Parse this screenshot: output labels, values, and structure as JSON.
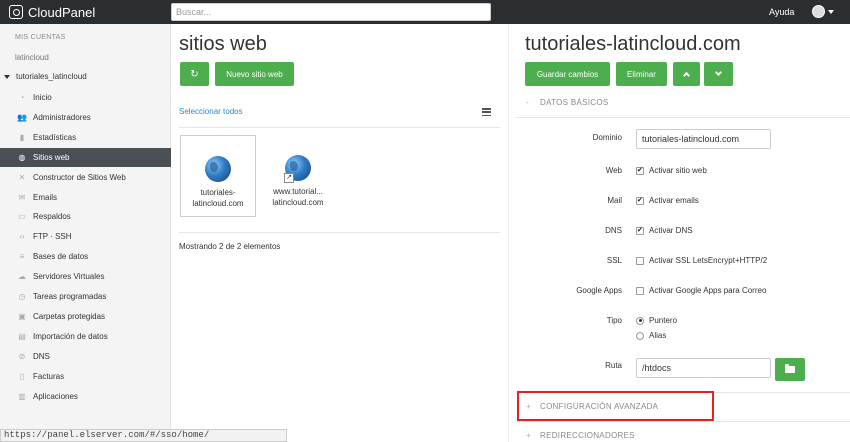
{
  "topbar": {
    "brand": "CloudPanel",
    "search_placeholder": "Buscar...",
    "help_label": "Ayuda"
  },
  "sidebar": {
    "section_heading": "MIS CUENTAS",
    "account": "latincloud",
    "subaccount": "tutoriales_latincloud",
    "items": [
      {
        "label": "Inicio",
        "icon": "dashboard-icon"
      },
      {
        "label": "Administradores",
        "icon": "users-icon"
      },
      {
        "label": "Estadísticas",
        "icon": "stats-icon"
      },
      {
        "label": "Sitios web",
        "icon": "globe-icon",
        "active": true
      },
      {
        "label": "Constructor de Sitios Web",
        "icon": "wrench-icon"
      },
      {
        "label": "Emails",
        "icon": "mail-icon"
      },
      {
        "label": "Respaldos",
        "icon": "backup-icon"
      },
      {
        "label": "FTP · SSH",
        "icon": "code-icon"
      },
      {
        "label": "Bases de datos",
        "icon": "database-icon"
      },
      {
        "label": "Servidores Virtuales",
        "icon": "cloud-icon"
      },
      {
        "label": "Tareas programadas",
        "icon": "clock-icon"
      },
      {
        "label": "Carpetas protegidas",
        "icon": "lock-icon"
      },
      {
        "label": "Importación de datos",
        "icon": "import-icon"
      },
      {
        "label": "DNS",
        "icon": "dns-icon"
      },
      {
        "label": "Facturas",
        "icon": "invoice-icon"
      },
      {
        "label": "Aplicaciones",
        "icon": "apps-icon"
      }
    ]
  },
  "websites": {
    "title": "sitios web",
    "new_site_label": "Nuevo sitio web",
    "select_all_label": "Seleccionar todos",
    "sites": [
      {
        "line1": "tutoriales-",
        "line2": "latincloud.com",
        "selected": true
      },
      {
        "line1": "www.tutorial...",
        "line2": "latincloud.com",
        "selected": false
      }
    ],
    "showing_text": "Mostrando 2 de 2 elementos"
  },
  "detail": {
    "title": "tutoriales-latincloud.com",
    "save_label": "Guardar cambios",
    "delete_label": "Eliminar",
    "basic_section": "DATOS BÁSICOS",
    "basic_sign": "-",
    "domain_label": "Dominio",
    "domain_value": "tutoriales-latincloud.com",
    "web_label": "Web",
    "web_option": "Activar sitio web",
    "mail_label": "Mail",
    "mail_option": "Activar emails",
    "dns_label": "DNS",
    "dns_option": "Activar DNS",
    "ssl_label": "SSL",
    "ssl_option": "Activar SSL LetsEncrypt+HTTP/2",
    "gapps_label": "Google Apps",
    "gapps_option": "Activar Google Apps para Correo",
    "type_label": "Tipo",
    "type_options": [
      "Puntero",
      "Alias"
    ],
    "type_selected": "Puntero",
    "path_label": "Ruta",
    "path_value": "/htdocs",
    "advanced_section": "CONFIGURACIÓN AVANZADA",
    "advanced_sign": "+",
    "redirects_section": "REDIRECCIONADORES",
    "redirects_sign": "+"
  },
  "status_url": "https://panel.elserver.com/#/sso/home/",
  "colors": {
    "topbar": "#2b2e30",
    "accent_green": "#4cae4c",
    "link_blue": "#2a8bc4",
    "highlight_red": "#e02424",
    "active_nav": "#4a5054"
  }
}
